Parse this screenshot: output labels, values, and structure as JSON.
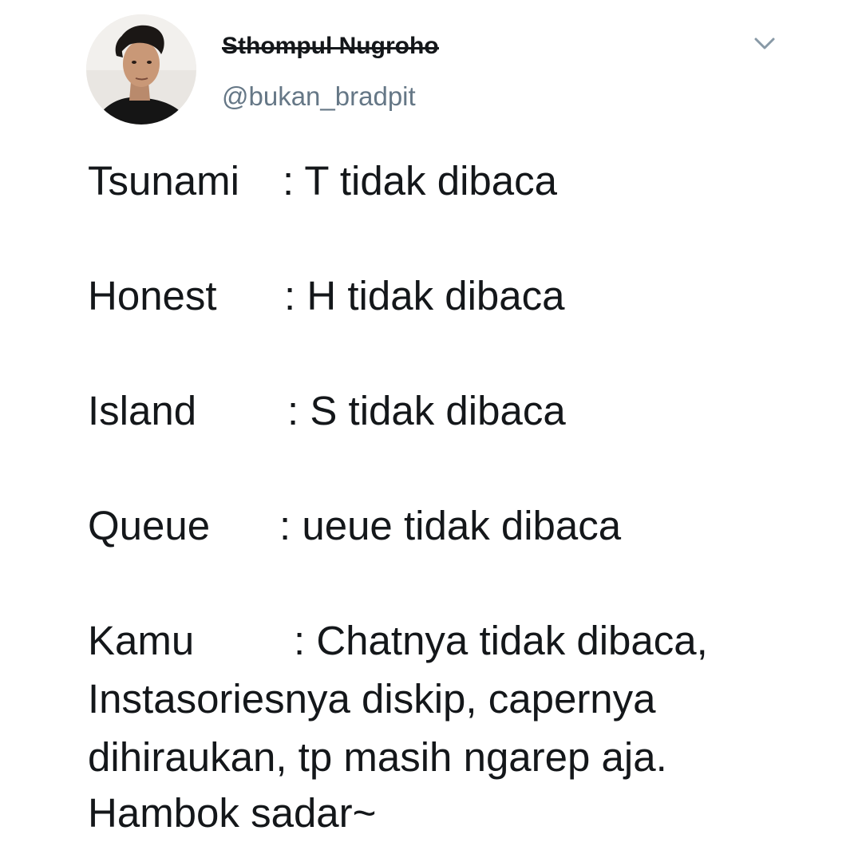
{
  "tweet": {
    "author": {
      "display_name": "Sthompul Nugroho",
      "handle": "@bukan_bradpit",
      "avatar_icon": "user-avatar"
    },
    "menu_icon": "chevron-down-icon",
    "lines": [
      {
        "term": "Tsunami",
        "definition": ": T tidak dibaca"
      },
      {
        "term": "Honest",
        "definition": ": H tidak dibaca"
      },
      {
        "term": "Island",
        "definition": ": S tidak dibaca"
      },
      {
        "term": "Queue",
        "definition": ": ueue tidak dibaca"
      },
      {
        "term": "Kamu",
        "definition": ": Chatnya tidak dibaca,"
      }
    ],
    "continuation": [
      "Instasoriesnya diskip, capernya",
      "dihiraukan, tp masih ngarep aja.",
      "Hambok sadar~"
    ]
  },
  "colors": {
    "text": "#14171a",
    "secondary": "#657786",
    "caret": "#8899a6"
  }
}
